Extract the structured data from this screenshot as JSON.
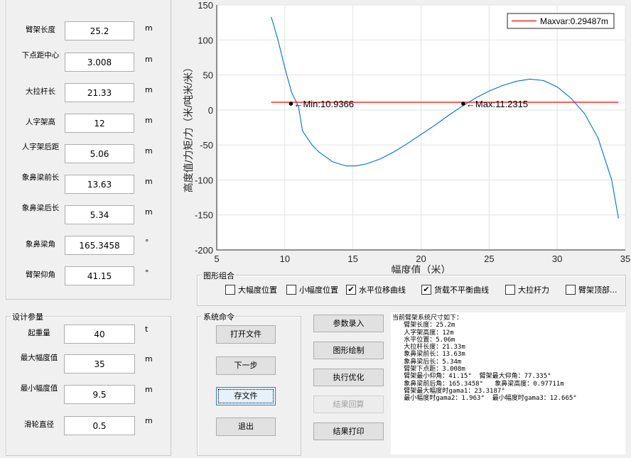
{
  "struct_panel": {
    "fields": [
      {
        "label": "臂架长度",
        "value": "25.2",
        "unit": "m"
      },
      {
        "label": "下点距中心",
        "value": "3.008",
        "unit": "m"
      },
      {
        "label": "大拉杆长",
        "value": "21.33",
        "unit": "m"
      },
      {
        "label": "人字架高",
        "value": "12",
        "unit": "m"
      },
      {
        "label": "人字架后距",
        "value": "5.06",
        "unit": "m"
      },
      {
        "label": "象鼻梁前长",
        "value": "13.63",
        "unit": "m"
      },
      {
        "label": "象鼻梁后长",
        "value": "5.34",
        "unit": "m"
      },
      {
        "label": "象鼻梁角",
        "value": "165.3458",
        "unit": "°"
      },
      {
        "label": "臂架仰角",
        "value": "41.15",
        "unit": "°"
      }
    ]
  },
  "design_panel": {
    "title": "设计参量",
    "fields": [
      {
        "label": "起重量",
        "value": "40",
        "unit": "t"
      },
      {
        "label": "最大幅度值",
        "value": "35",
        "unit": "m"
      },
      {
        "label": "最小幅度值",
        "value": "9.5",
        "unit": "m"
      },
      {
        "label": "滑轮直径",
        "value": "0.5",
        "unit": "m"
      }
    ]
  },
  "graph_group": {
    "title": "图形组合",
    "options": [
      {
        "label": "大幅度位置",
        "checked": false
      },
      {
        "label": "小幅度位置",
        "checked": false
      },
      {
        "label": "水平位移曲线",
        "checked": true
      },
      {
        "label": "货载不平衡曲线",
        "checked": true
      },
      {
        "label": "大拉杆力",
        "checked": false
      },
      {
        "label": "臂架顶部...",
        "checked": false
      }
    ]
  },
  "system_panel": {
    "title": "系统命令",
    "buttons": [
      "打开文件",
      "下一步",
      "存文件",
      "退出"
    ]
  },
  "action_buttons": [
    "参数录入",
    "图形绘制",
    "执行优化",
    "结果回算",
    "结果打印"
  ],
  "output_text": "当前臂架系统尺寸如下：\n   臂架长度：25.2m\n   人字架高度：12m\n   水平位置：5.06m\n   大拉杆长度：21.33m\n   象鼻梁前长：13.63m\n   象鼻梁后长：5.34m\n   臂架下点距：3.008m\n   臂架最小仰角：41.15°  臂架最大仰角：77.335°\n   象鼻梁前后角：165.3458°   象鼻梁高度：0.97711m\n   臂架最大幅度时gama1：23.3187°\n   最小幅度时gama2：1.963°  最小幅度时gama3：12.665°",
  "chart_data": {
    "type": "line",
    "xlabel": "幅度值（米）",
    "ylabel": "高度值/力矩/力（米/吨米/米）",
    "xlim": [
      5,
      35
    ],
    "ylim": [
      -200,
      150
    ],
    "xticks": [
      5,
      10,
      15,
      20,
      25,
      30,
      35
    ],
    "yticks": [
      150,
      100,
      50,
      0,
      -50,
      -100,
      -150,
      -200
    ],
    "grid": true,
    "legend": {
      "position": "top-right",
      "entries": [
        "Maxvar:0.29487m"
      ]
    },
    "series": [
      {
        "name": "curve",
        "color": "#0072bd",
        "x": [
          9,
          9.5,
          10,
          10.5,
          11,
          11.3,
          12,
          12.5,
          13.5,
          14.5,
          15.2,
          16,
          17,
          18,
          19,
          20,
          21,
          22,
          23,
          24,
          25,
          26,
          27,
          28,
          29,
          30,
          31,
          32,
          33,
          34,
          34.5
        ],
        "y": [
          133,
          100,
          60,
          25,
          5,
          -30,
          -50,
          -60,
          -74,
          -80,
          -80,
          -77,
          -70,
          -60,
          -48,
          -35,
          -22,
          -8,
          5,
          17,
          27,
          35,
          41,
          44,
          42,
          33,
          17,
          -5,
          -40,
          -100,
          -155
        ]
      },
      {
        "name": "Maxvar:0.29487m",
        "color": "#ff0000",
        "x": [
          9,
          34.5
        ],
        "y": [
          11,
          11
        ]
      }
    ],
    "annotations": [
      {
        "text": "←Min:10.9366",
        "x": 10.45,
        "y": 9
      },
      {
        "text": "←Max:11.2315",
        "x": 23.1,
        "y": 9
      }
    ]
  }
}
